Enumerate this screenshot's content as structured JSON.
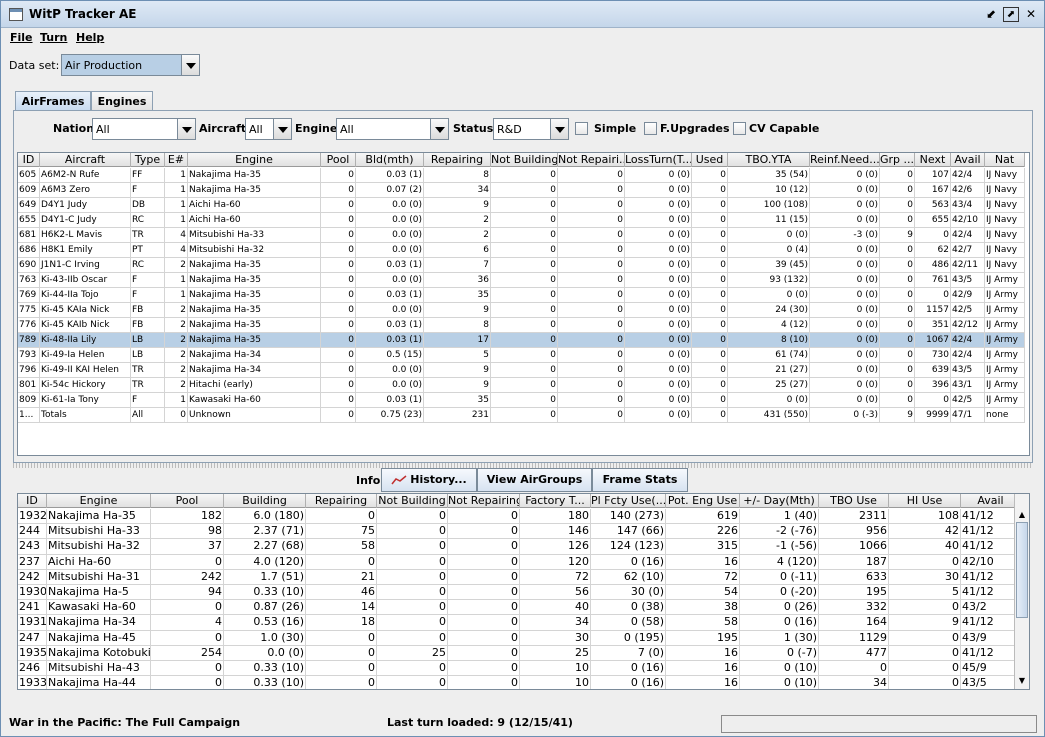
{
  "window": {
    "title": "WitP Tracker AE",
    "minimize_glyph": "⬋",
    "maximize_glyph": "⬈",
    "close_glyph": "✕"
  },
  "menu": [
    "File",
    "Turn",
    "Help"
  ],
  "dataset": {
    "label": "Data set:",
    "value": "Air Production"
  },
  "tabs": [
    {
      "label": "AirFrames",
      "active": true
    },
    {
      "label": "Engines",
      "active": false
    }
  ],
  "filters": {
    "nation_label": "Nation:",
    "nation_value": "All",
    "aircraft_label": "Aircraft:",
    "aircraft_value": "All",
    "engine_label": "Engine:",
    "engine_value": "All",
    "status_label": "Status:",
    "status_value": "R&D",
    "checkboxes": [
      "Simple",
      "F.Upgrades",
      "CV Capable"
    ]
  },
  "airframes": {
    "columns": [
      "ID",
      "Aircraft",
      "Type",
      "E#",
      "Engine",
      "Pool",
      "Bld(mth)",
      "Repairing",
      "Not Building",
      "Not Repairi...",
      "LossTurn(T...",
      "Used",
      "TBO.YTA",
      "Reinf.Need...",
      "Grp ...",
      "Next",
      "Avail",
      "Nat"
    ],
    "rows": [
      [
        "605",
        "A6M2-N Rufe",
        "FF",
        "1",
        "Nakajima Ha-35",
        "0",
        "0.03 (1)",
        "8",
        "0",
        "0",
        "0 (0)",
        "0",
        "35 (54)",
        "0 (0)",
        "0",
        "107",
        "42/4",
        "IJ Navy"
      ],
      [
        "609",
        "A6M3 Zero",
        "F",
        "1",
        "Nakajima Ha-35",
        "0",
        "0.07 (2)",
        "34",
        "0",
        "0",
        "0 (0)",
        "0",
        "10 (12)",
        "0 (0)",
        "0",
        "167",
        "42/6",
        "IJ Navy"
      ],
      [
        "649",
        "D4Y1 Judy",
        "DB",
        "1",
        "Aichi Ha-60",
        "0",
        "0.0 (0)",
        "9",
        "0",
        "0",
        "0 (0)",
        "0",
        "100 (108)",
        "0 (0)",
        "0",
        "563",
        "43/4",
        "IJ Navy"
      ],
      [
        "655",
        "D4Y1-C Judy",
        "RC",
        "1",
        "Aichi Ha-60",
        "0",
        "0.0 (0)",
        "2",
        "0",
        "0",
        "0 (0)",
        "0",
        "11 (15)",
        "0 (0)",
        "0",
        "655",
        "42/10",
        "IJ Navy"
      ],
      [
        "681",
        "H6K2-L Mavis",
        "TR",
        "4",
        "Mitsubishi Ha-33",
        "0",
        "0.0 (0)",
        "2",
        "0",
        "0",
        "0 (0)",
        "0",
        "0 (0)",
        "-3 (0)",
        "9",
        "0",
        "42/4",
        "IJ Navy"
      ],
      [
        "686",
        "H8K1 Emily",
        "PT",
        "4",
        "Mitsubishi Ha-32",
        "0",
        "0.0 (0)",
        "6",
        "0",
        "0",
        "0 (0)",
        "0",
        "0 (4)",
        "0 (0)",
        "0",
        "62",
        "42/7",
        "IJ Navy"
      ],
      [
        "690",
        "J1N1-C Irving",
        "RC",
        "2",
        "Nakajima Ha-35",
        "0",
        "0.03 (1)",
        "7",
        "0",
        "0",
        "0 (0)",
        "0",
        "39 (45)",
        "0 (0)",
        "0",
        "486",
        "42/11",
        "IJ Navy"
      ],
      [
        "763",
        "Ki-43-IIb Oscar",
        "F",
        "1",
        "Nakajima Ha-35",
        "0",
        "0.0 (0)",
        "36",
        "0",
        "0",
        "0 (0)",
        "0",
        "93 (132)",
        "0 (0)",
        "0",
        "761",
        "43/5",
        "IJ Army"
      ],
      [
        "769",
        "Ki-44-IIa Tojo",
        "F",
        "1",
        "Nakajima Ha-35",
        "0",
        "0.03 (1)",
        "35",
        "0",
        "0",
        "0 (0)",
        "0",
        "0 (0)",
        "0 (0)",
        "0",
        "0",
        "42/9",
        "IJ Army"
      ],
      [
        "775",
        "Ki-45 KAIa Nick",
        "FB",
        "2",
        "Nakajima Ha-35",
        "0",
        "0.0 (0)",
        "9",
        "0",
        "0",
        "0 (0)",
        "0",
        "24 (30)",
        "0 (0)",
        "0",
        "1157",
        "42/5",
        "IJ Army"
      ],
      [
        "776",
        "Ki-45 KAIb Nick",
        "FB",
        "2",
        "Nakajima Ha-35",
        "0",
        "0.03 (1)",
        "8",
        "0",
        "0",
        "0 (0)",
        "0",
        "4 (12)",
        "0 (0)",
        "0",
        "351",
        "42/12",
        "IJ Army"
      ],
      [
        "789",
        "Ki-48-IIa Lily",
        "LB",
        "2",
        "Nakajima Ha-35",
        "0",
        "0.03 (1)",
        "17",
        "0",
        "0",
        "0 (0)",
        "0",
        "8 (10)",
        "0 (0)",
        "0",
        "1067",
        "42/4",
        "IJ Army"
      ],
      [
        "793",
        "Ki-49-Ia Helen",
        "LB",
        "2",
        "Nakajima Ha-34",
        "0",
        "0.5 (15)",
        "5",
        "0",
        "0",
        "0 (0)",
        "0",
        "61 (74)",
        "0 (0)",
        "0",
        "730",
        "42/4",
        "IJ Army"
      ],
      [
        "796",
        "Ki-49-II KAI Helen",
        "TR",
        "2",
        "Nakajima Ha-34",
        "0",
        "0.0 (0)",
        "9",
        "0",
        "0",
        "0 (0)",
        "0",
        "21 (27)",
        "0 (0)",
        "0",
        "639",
        "43/5",
        "IJ Army"
      ],
      [
        "801",
        "Ki-54c Hickory",
        "TR",
        "2",
        "Hitachi (early)",
        "0",
        "0.0 (0)",
        "9",
        "0",
        "0",
        "0 (0)",
        "0",
        "25 (27)",
        "0 (0)",
        "0",
        "396",
        "43/1",
        "IJ Army"
      ],
      [
        "809",
        "Ki-61-Ia Tony",
        "F",
        "1",
        "Kawasaki Ha-60",
        "0",
        "0.03 (1)",
        "35",
        "0",
        "0",
        "0 (0)",
        "0",
        "0 (0)",
        "0 (0)",
        "0",
        "0",
        "42/5",
        "IJ Army"
      ],
      [
        "1...",
        "Totals",
        "All",
        "0",
        "Unknown",
        "0",
        "0.75 (23)",
        "231",
        "0",
        "0",
        "0 (0)",
        "0",
        "431 (550)",
        "0 (-3)",
        "9",
        "9999",
        "47/1",
        "none"
      ]
    ],
    "selected_row": 11
  },
  "info": {
    "label": "Info:",
    "buttons": [
      "History...",
      "View AirGroups",
      "Frame Stats"
    ]
  },
  "engines": {
    "columns": [
      "ID",
      "Engine",
      "Pool",
      "Building",
      "Repairing",
      "Not Building",
      "Not Repairing",
      "Factory T...",
      "Pl Fcty Use(...",
      "Pot. Eng Use",
      "+/- Day(Mth)",
      "TBO Use",
      "HI Use",
      "Avail"
    ],
    "rows": [
      [
        "1932",
        "Nakajima Ha-35",
        "182",
        "6.0 (180)",
        "0",
        "0",
        "0",
        "180",
        "140 (273)",
        "619",
        "1 (40)",
        "2311",
        "108",
        "41/12"
      ],
      [
        "244",
        "Mitsubishi Ha-33",
        "98",
        "2.37 (71)",
        "75",
        "0",
        "0",
        "146",
        "147 (66)",
        "226",
        "-2 (-76)",
        "956",
        "42",
        "41/12"
      ],
      [
        "243",
        "Mitsubishi Ha-32",
        "37",
        "2.27 (68)",
        "58",
        "0",
        "0",
        "126",
        "124 (123)",
        "315",
        "-1 (-56)",
        "1066",
        "40",
        "41/12"
      ],
      [
        "237",
        "Aichi Ha-60",
        "0",
        "4.0 (120)",
        "0",
        "0",
        "0",
        "120",
        "0 (16)",
        "16",
        "4 (120)",
        "187",
        "0",
        "42/10"
      ],
      [
        "242",
        "Mitsubishi Ha-31",
        "242",
        "1.7 (51)",
        "21",
        "0",
        "0",
        "72",
        "62 (10)",
        "72",
        "0 (-11)",
        "633",
        "30",
        "41/12"
      ],
      [
        "1930",
        "Nakajima Ha-5",
        "94",
        "0.33 (10)",
        "46",
        "0",
        "0",
        "56",
        "30 (0)",
        "54",
        "0 (-20)",
        "195",
        "5",
        "41/12"
      ],
      [
        "241",
        "Kawasaki Ha-60",
        "0",
        "0.87 (26)",
        "14",
        "0",
        "0",
        "40",
        "0 (38)",
        "38",
        "0 (26)",
        "332",
        "0",
        "43/2"
      ],
      [
        "1931",
        "Nakajima Ha-34",
        "4",
        "0.53 (16)",
        "18",
        "0",
        "0",
        "34",
        "0 (58)",
        "58",
        "0 (16)",
        "164",
        "9",
        "41/12"
      ],
      [
        "247",
        "Nakajima Ha-45",
        "0",
        "1.0 (30)",
        "0",
        "0",
        "0",
        "30",
        "0 (195)",
        "195",
        "1 (30)",
        "1129",
        "0",
        "43/9"
      ],
      [
        "1935",
        "Nakajima Kotobuki",
        "254",
        "0.0 (0)",
        "0",
        "25",
        "0",
        "25",
        "7 (0)",
        "16",
        "0 (-7)",
        "477",
        "0",
        "41/12"
      ],
      [
        "246",
        "Mitsubishi Ha-43",
        "0",
        "0.33 (10)",
        "0",
        "0",
        "0",
        "10",
        "0 (16)",
        "16",
        "0 (10)",
        "0",
        "0",
        "45/9"
      ],
      [
        "1933",
        "Nakajima Ha-44",
        "0",
        "0.33 (10)",
        "0",
        "0",
        "0",
        "10",
        "0 (16)",
        "16",
        "0 (10)",
        "34",
        "0",
        "43/5"
      ]
    ]
  },
  "status": {
    "left": "War in the Pacific: The Full Campaign",
    "center": "Last turn loaded: 9 (12/15/41)"
  }
}
